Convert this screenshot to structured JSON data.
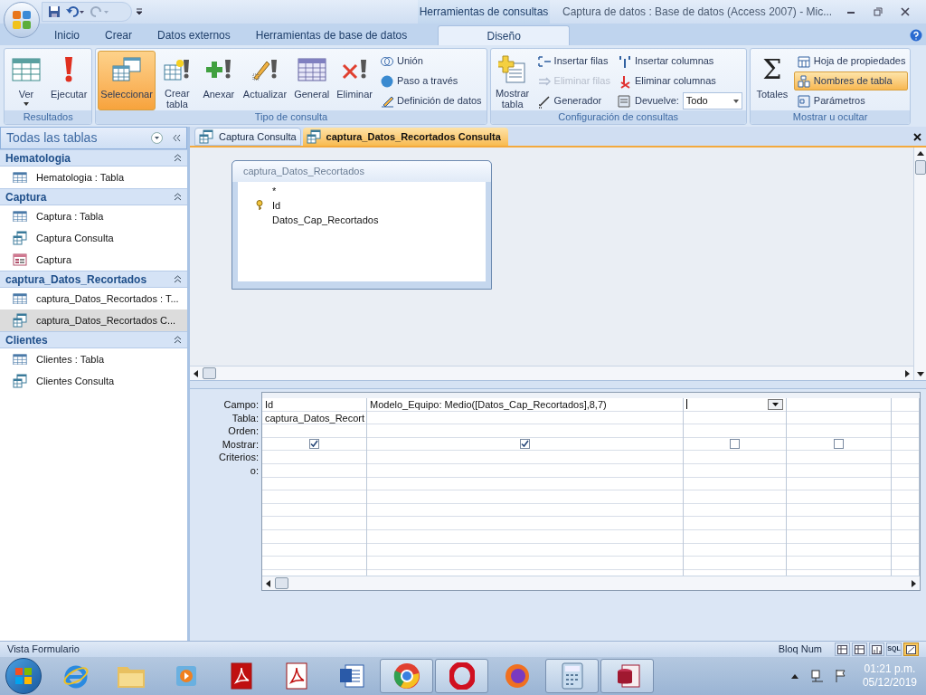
{
  "window": {
    "title": "Captura de datos : Base de datos (Access 2007) - Mic...",
    "contextual_tab": "Herramientas de consultas"
  },
  "tabs": [
    {
      "label": "Inicio",
      "selected": false
    },
    {
      "label": "Crear",
      "selected": false
    },
    {
      "label": "Datos externos",
      "selected": false
    },
    {
      "label": "Herramientas de base de datos",
      "selected": false
    },
    {
      "label": "Diseño",
      "selected": true
    }
  ],
  "ribbon_groups": [
    {
      "label": "Resultados",
      "items": [
        {
          "kind": "large",
          "label": "Ver",
          "dropdown": true,
          "selected": false
        },
        {
          "kind": "large",
          "label": "Ejecutar",
          "selected": false
        }
      ]
    },
    {
      "label": "Tipo de consulta",
      "items": [
        {
          "kind": "large",
          "label": "Seleccionar",
          "selected": true
        },
        {
          "kind": "large",
          "label": "Crear tabla",
          "selected": false
        },
        {
          "kind": "large",
          "label": "Anexar",
          "selected": false
        },
        {
          "kind": "large",
          "label": "Actualizar",
          "selected": false
        },
        {
          "kind": "large",
          "label": "General",
          "selected": false
        },
        {
          "kind": "large",
          "label": "Eliminar",
          "selected": false
        },
        {
          "kind": "small",
          "label": "Unión",
          "disabled": false,
          "selected": false
        },
        {
          "kind": "small",
          "label": "Paso a través",
          "disabled": false,
          "selected": false
        },
        {
          "kind": "small",
          "label": "Definición de datos",
          "disabled": false,
          "selected": false
        }
      ]
    },
    {
      "label": "Configuración de consultas",
      "items": [
        {
          "kind": "large",
          "label": "Mostrar tabla",
          "selected": false
        },
        {
          "kind": "small",
          "label": "Insertar filas",
          "disabled": false,
          "selected": false
        },
        {
          "kind": "small",
          "label": "Eliminar filas",
          "disabled": true,
          "selected": false
        },
        {
          "kind": "small",
          "label": "Generador",
          "disabled": false,
          "selected": false
        },
        {
          "kind": "small",
          "label": "Insertar columnas",
          "disabled": false,
          "selected": false
        },
        {
          "kind": "small",
          "label": "Eliminar columnas",
          "disabled": false,
          "selected": false
        },
        {
          "kind": "combo",
          "label": "Devuelve:",
          "value": "Todo"
        }
      ]
    },
    {
      "label": "Mostrar u ocultar",
      "items": [
        {
          "kind": "large",
          "label": "Totales",
          "symbol": "Σ",
          "selected": false
        },
        {
          "kind": "small",
          "label": "Hoja de propiedades",
          "disabled": false,
          "selected": false
        },
        {
          "kind": "small",
          "label": "Nombres de tabla",
          "disabled": false,
          "selected": true
        },
        {
          "kind": "small",
          "label": "Parámetros",
          "disabled": false,
          "selected": false
        }
      ]
    }
  ],
  "navigation": {
    "title": "Todas las tablas",
    "groups": [
      {
        "title": "Hematologia",
        "expanded": true,
        "items": [
          {
            "kind": "table",
            "label": "Hematologia : Tabla",
            "selected": false
          }
        ]
      },
      {
        "title": "Captura",
        "expanded": true,
        "items": [
          {
            "kind": "table",
            "label": "Captura : Tabla",
            "selected": false
          },
          {
            "kind": "query",
            "label": "Captura Consulta",
            "selected": false
          },
          {
            "kind": "form",
            "label": "Captura",
            "selected": false
          }
        ]
      },
      {
        "title": "captura_Datos_Recortados",
        "expanded": true,
        "items": [
          {
            "kind": "table",
            "label": "captura_Datos_Recortados : T...",
            "selected": false
          },
          {
            "kind": "query",
            "label": "captura_Datos_Recortados C...",
            "selected": true
          }
        ]
      },
      {
        "title": "Clientes",
        "expanded": true,
        "items": [
          {
            "kind": "table",
            "label": "Clientes : Tabla",
            "selected": false
          },
          {
            "kind": "query",
            "label": "Clientes Consulta",
            "selected": false
          }
        ]
      }
    ]
  },
  "document_tabs": [
    {
      "label": "Captura Consulta",
      "selected": false
    },
    {
      "label": "captura_Datos_Recortados Consulta",
      "selected": true
    }
  ],
  "table_box": {
    "title": "captura_Datos_Recortados",
    "fields": [
      {
        "name": "*",
        "primary_key": false
      },
      {
        "name": "Id",
        "primary_key": true
      },
      {
        "name": "Datos_Cap_Recortados",
        "primary_key": false
      }
    ]
  },
  "design_grid": {
    "row_labels": [
      "Campo:",
      "Tabla:",
      "Orden:",
      "Mostrar:",
      "Criterios:",
      "o:"
    ],
    "columns": [
      {
        "campo": "Id",
        "tabla": "captura_Datos_Recort",
        "mostrar": true,
        "focused": false
      },
      {
        "campo": "Modelo_Equipo: Medio([Datos_Cap_Recortados],8,7)",
        "mostrar": true,
        "focused": false
      },
      {
        "mostrar": false,
        "focused": true
      },
      {
        "mostrar": false,
        "focused": false
      }
    ]
  },
  "status_bar": {
    "left": "Vista Formulario",
    "right": "Bloq Num",
    "views": [
      {
        "kind": "datasheet",
        "selected": false
      },
      {
        "kind": "pivot",
        "selected": false
      },
      {
        "kind": "chart",
        "selected": false
      },
      {
        "kind": "sql",
        "label": "SQL",
        "selected": false
      },
      {
        "kind": "design",
        "selected": true
      }
    ]
  },
  "taskbar": {
    "apps": [
      {
        "kind": "ie",
        "open": false
      },
      {
        "kind": "folder",
        "open": false
      },
      {
        "kind": "media",
        "open": false
      },
      {
        "kind": "pdf",
        "open": false
      },
      {
        "kind": "pdf2",
        "open": false
      },
      {
        "kind": "word",
        "open": false
      },
      {
        "kind": "chrome",
        "open": true
      },
      {
        "kind": "opera",
        "open": true
      },
      {
        "kind": "firefox",
        "open": false
      },
      {
        "kind": "calculator",
        "open": true
      },
      {
        "kind": "access",
        "open": true
      }
    ],
    "time": "01:21 p.m.",
    "date": "05/12/2019"
  }
}
